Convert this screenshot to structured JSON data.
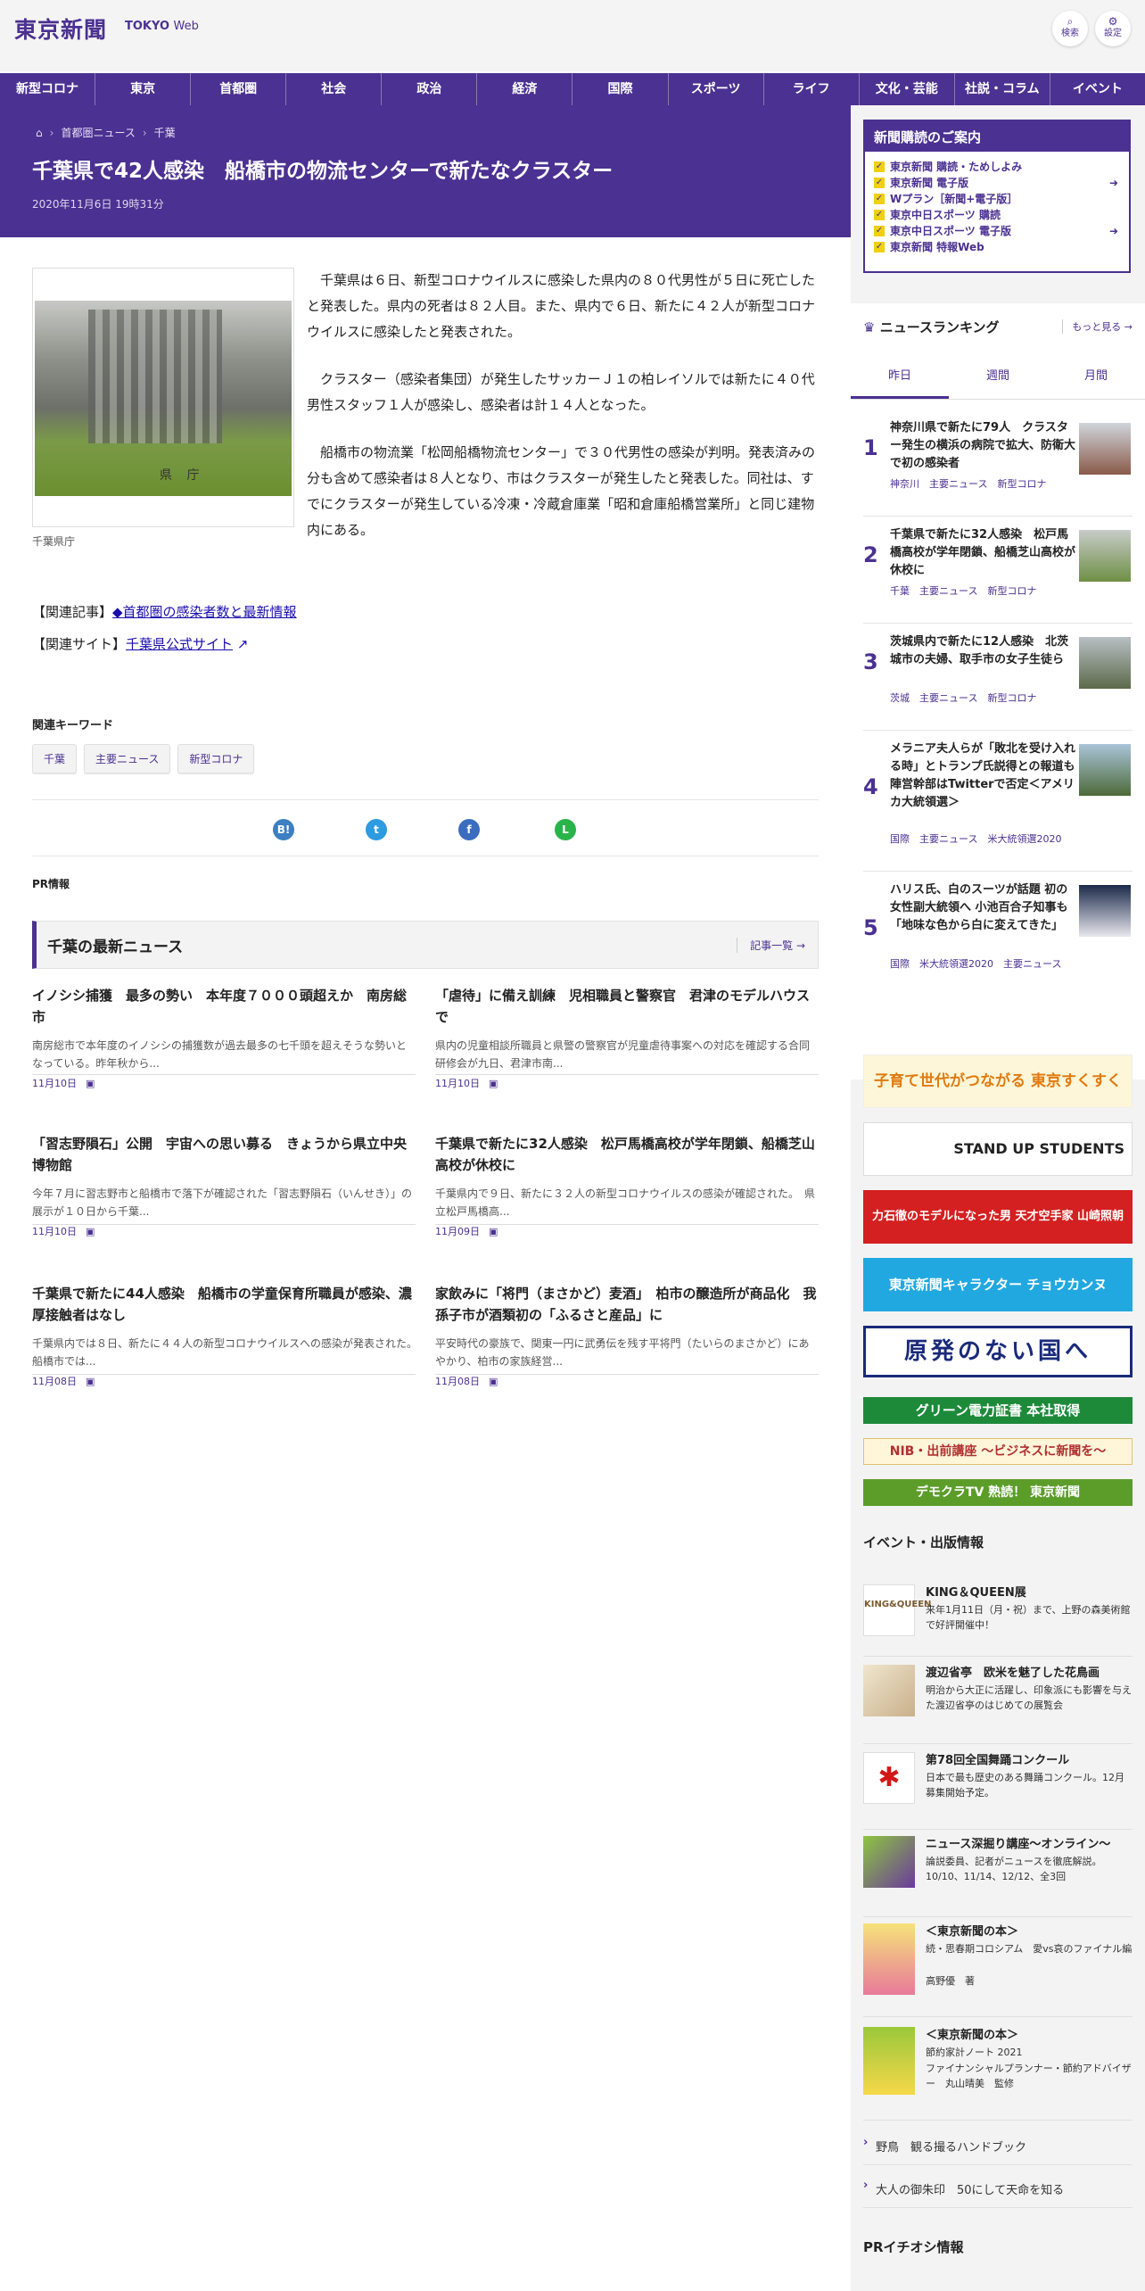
{
  "header": {
    "logo": "東京新聞",
    "logo_sub": "TOKYO",
    "logo_sub2": "Web",
    "search_label": "検索",
    "settings_label": "設定"
  },
  "nav": [
    "新型コロナ",
    "東京",
    "首都圏",
    "社会",
    "政治",
    "経済",
    "国際",
    "スポーツ",
    "ライフ",
    "文化・芸能",
    "社説・コラム",
    "イベント"
  ],
  "breadcrumb": {
    "items": [
      "首都圏ニュース",
      "千葉"
    ]
  },
  "article": {
    "title": "千葉県で42人感染　船橋市の物流センターで新たなクラスター",
    "date": "2020年11月6日 19時31分",
    "caption": "千葉県庁",
    "paragraphs": [
      "千葉県は６日、新型コロナウイルスに感染した県内の８０代男性が５日に死亡したと発表した。県内の死者は８２人目。また、県内で６日、新たに４２人が新型コロナウイルスに感染したと発表された。",
      "クラスター（感染者集団）が発生したサッカーＪ１の柏レイソルでは新たに４０代男性スタッフ１人が感染し、感染者は計１４人となった。",
      "船橋市の物流業「松岡船橋物流センター」で３０代男性の感染が判明。発表済みの分も含めて感染者は８人となり、市はクラスターが発生したと発表した。同社は、すでにクラスターが発生している冷凍・冷蔵倉庫業「昭和倉庫船橋営業所」と同じ建物内にある。"
    ],
    "related_article_label": "【関連記事】",
    "related_article_link": "◆首都圏の感染者数と最新情報",
    "related_site_label": "【関連サイト】",
    "related_site_link": "千葉県公式サイト"
  },
  "keywords": {
    "title": "関連キーワード",
    "items": [
      "千葉",
      "主要ニュース",
      "新型コロナ"
    ]
  },
  "share": [
    {
      "name": "hatena",
      "label": "B!",
      "color": "#3d7fc1"
    },
    {
      "name": "twitter",
      "label": "t",
      "color": "#2d9be0"
    },
    {
      "name": "facebook",
      "label": "f",
      "color": "#3b6dbf"
    },
    {
      "name": "line",
      "label": "L",
      "color": "#29b44a"
    }
  ],
  "pr_label": "PR情報",
  "latest": {
    "title": "千葉の最新ニュース",
    "more": "記事一覧",
    "items": [
      {
        "title": "イノシシ捕獲　最多の勢い　本年度７０００頭超えか　南房総市",
        "desc": "南房総市で本年度のイノシシの捕獲数が過去最多の七千頭を超えそうな勢いとなっている。昨年秋から...",
        "date": "11月10日"
      },
      {
        "title": "「虐待」に備え訓練　児相職員と警察官　君津のモデルハウスで",
        "desc": "県内の児童相談所職員と県警の警察官が児童虐待事案への対応を確認する合同研修会が九日、君津市南...",
        "date": "11月10日"
      },
      {
        "title": "「習志野隕石」公開　宇宙への思い募る　きょうから県立中央博物館",
        "desc": "今年７月に習志野市と船橋市で落下が確認された「習志野隕石（いんせき）」の展示が１０日から千葉...",
        "date": "11月10日"
      },
      {
        "title": "千葉県で新たに32人感染　松戸馬橋高校が学年閉鎖、船橋芝山高校が休校に",
        "desc": "千葉県内で９日、新たに３２人の新型コロナウイルスの感染が確認された。　県立松戸馬橋高...",
        "date": "11月09日"
      },
      {
        "title": "千葉県で新たに44人感染　船橋市の学童保育所職員が感染、濃厚接触者はなし",
        "desc": "千葉県内では８日、新たに４４人の新型コロナウイルスへの感染が発表された。　船橋市では...",
        "date": "11月08日"
      },
      {
        "title": "家飲みに「将門（まさかど）麦酒」　柏市の醸造所が商品化　我孫子市が酒類初の「ふるさと産品」に",
        "desc": "平安時代の豪族で、関東一円に武勇伝を残す平将門（たいらのまさかど）にあやかり、柏市の家族経営...",
        "date": "11月08日"
      }
    ]
  },
  "subscribe": {
    "title": "新聞購読のご案内",
    "items": [
      "東京新聞 購読・ためしよみ",
      "東京新聞 電子版",
      "Wプラン［新聞+電子版］",
      "東京中日スポーツ 購読",
      "東京中日スポーツ 電子版",
      "東京新聞 特報Web"
    ]
  },
  "ranking": {
    "title": "ニュースランキング",
    "more": "もっと見る",
    "tabs": [
      "昨日",
      "週間",
      "月間"
    ],
    "items": [
      {
        "n": "1",
        "title": "神奈川県で新たに79人　クラスター発生の横浜の病院で拡大、防衛大で初の感染者",
        "tags": "神奈川　主要ニュース　新型コロナ"
      },
      {
        "n": "2",
        "title": "千葉県で新たに32人感染　松戸馬橋高校が学年閉鎖、船橋芝山高校が休校に",
        "tags": "千葉　主要ニュース　新型コロナ"
      },
      {
        "n": "3",
        "title": "茨城県内で新たに12人感染　北茨城市の夫婦、取手市の女子生徒ら",
        "tags": "茨城　主要ニュース　新型コロナ"
      },
      {
        "n": "4",
        "title": "メラニア夫人らが「敗北を受け入れる時」とトランプ氏説得との報道も　陣営幹部はTwitterで否定＜アメリカ大統領選＞",
        "tags": "国際　主要ニュース　米大統領選2020"
      },
      {
        "n": "5",
        "title": "ハリス氏、白のスーツが話題 初の女性副大統領へ 小池百合子知事も「地味な色から白に変えてきた」",
        "tags": "国際　米大統領選2020　主要ニュース"
      }
    ]
  },
  "banners": [
    {
      "text": "子育て世代がつながる 東京すくすく",
      "bg": "#fdf6d8",
      "fg": "#e07a10"
    },
    {
      "text": "STAND UP STUDENTS",
      "bg": "#ffffff",
      "fg": "#222222"
    },
    {
      "text": "力石徹のモデルになった男 天才空手家 山崎照朝",
      "bg": "#d42020",
      "fg": "#ffffff"
    },
    {
      "text": "東京新聞キャラクター チョウカンヌ",
      "bg": "#22a8e0",
      "fg": "#ffffff"
    },
    {
      "text": "原発のない国へ",
      "bg": "#ffffff",
      "fg": "#1a2a7a"
    },
    {
      "text": "グリーン電力証書 本社取得",
      "bg": "#1d8a3a",
      "fg": "#ffffff"
    },
    {
      "text": "NIB・出前講座 ～ビジネスに新聞を～",
      "bg": "#fff6da",
      "fg": "#b03030"
    },
    {
      "text": "デモクラTV 熟読！ 東京新聞",
      "bg": "#5c9d2a",
      "fg": "#ffffff"
    }
  ],
  "events": {
    "title": "イベント・出版情報",
    "items": [
      {
        "title": "KING＆QUEEN展",
        "desc": "来年1月11日（月・祝）まで、上野の森美術館で好評開催中！",
        "color": "#7a5a30"
      },
      {
        "title": "渡辺省亭　欧米を魅了した花鳥画",
        "desc": "明治から大正に活躍し、印象派にも影響を与えた渡辺省亭のはじめての展覧会",
        "color": "#c9b08a"
      },
      {
        "title": "第78回全国舞踊コンクール",
        "desc": "日本で最も歴史のある舞踊コンクール。12月募集開始予定。",
        "color": "#d01818"
      },
      {
        "title": "ニュース深掘り講座～オンライン～",
        "desc": "論説委員、記者がニュースを徹底解説。10/10、11/14、12/12、全3回",
        "color": "#6a3a9a"
      },
      {
        "title": "＜東京新聞の本＞",
        "desc": "続・思春期コロシアム　愛vs哀のファイナル編",
        "desc2": "高野優　著",
        "color": "#e87a9a"
      },
      {
        "title": "＜東京新聞の本＞",
        "desc": "節約家計ノート 2021",
        "desc2": "ファイナンシャルプランナー・節約アドバイザー　丸山晴美　監修",
        "color": "#9ac83a"
      }
    ]
  },
  "links": [
    "野鳥　観る撮るハンドブック",
    "大人の御朱印　50にして天命を知る"
  ],
  "pr_pick": "PRイチオシ情報"
}
